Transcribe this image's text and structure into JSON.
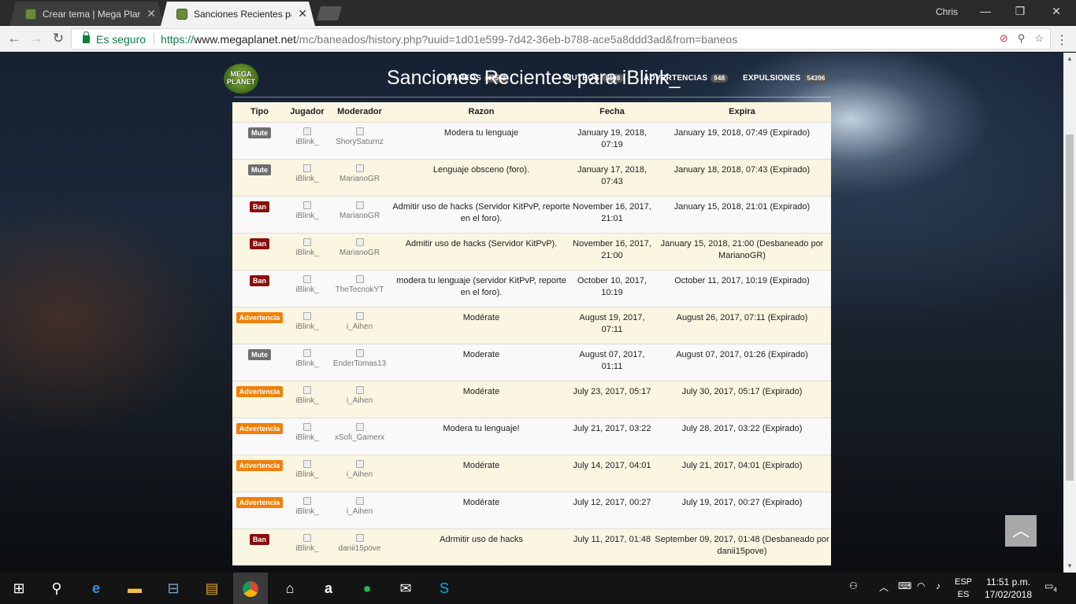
{
  "browser": {
    "tabs": [
      {
        "title": "Crear tema | Mega Planet"
      },
      {
        "title": "Sanciones Recientes para"
      }
    ],
    "profile": "Chris",
    "secure_label": "Es seguro",
    "url_scheme": "https://",
    "url_host": "www.megaplanet.net",
    "url_path": "/mc/baneados/history.php?uuid=1d01e599-7d42-36eb-b788-ace5a8ddd3ad&from=baneos"
  },
  "site": {
    "logo_text": "MEGA PLANET",
    "nav": [
      {
        "label": "BANEOS",
        "count": "47563"
      },
      {
        "label": "MUTEOS",
        "count": "8198"
      },
      {
        "label": "ADVERTENCIAS",
        "count": "948"
      },
      {
        "label": "EXPULSIONES",
        "count": "54396"
      }
    ],
    "title": "Sanciones Recientes para iBlink_"
  },
  "table": {
    "headers": [
      "Tipo",
      "Jugador",
      "Moderador",
      "Razon",
      "Fecha",
      "Expira"
    ],
    "rows": [
      {
        "type": "Mute",
        "player": "iBlink_",
        "moderator": "ShorySaturnz",
        "reason": "Modera tu lenguaje",
        "date": "January 19, 2018, 07:19",
        "expires": "January 19, 2018, 07:49 (Expirado)"
      },
      {
        "type": "Mute",
        "player": "iBlink_",
        "moderator": "MarianoGR",
        "reason": "Lenguaje obsceno (foro).",
        "date": "January 17, 2018, 07:43",
        "expires": "January 18, 2018, 07:43 (Expirado)"
      },
      {
        "type": "Ban",
        "player": "iBlink_",
        "moderator": "MarianoGR",
        "reason": "Admitir uso de hacks (Servidor KitPvP, reporte en el foro).",
        "date": "November 16, 2017, 21:01",
        "expires": "January 15, 2018, 21:01 (Expirado)"
      },
      {
        "type": "Ban",
        "player": "iBlink_",
        "moderator": "MarianoGR",
        "reason": "Admitir uso de hacks (Servidor KitPvP).",
        "date": "November 16, 2017, 21:00",
        "expires": "January 15, 2018, 21:00 (Desbaneado por MarianoGR)"
      },
      {
        "type": "Ban",
        "player": "iBlink_",
        "moderator": "TheTecnokYT",
        "reason": "moderа tu lenguaje (servidor KitPvP, reporte en el foro).",
        "date": "October 10, 2017, 10:19",
        "expires": "October 11, 2017, 10:19 (Expirado)"
      },
      {
        "type": "Advertencia",
        "player": "iBlink_",
        "moderator": "i_Aihen",
        "reason": "Modérate",
        "date": "August 19, 2017, 07:11",
        "expires": "August 26, 2017, 07:11 (Expirado)"
      },
      {
        "type": "Mute",
        "player": "iBlink_",
        "moderator": "EnderTomas13",
        "reason": "Moderate",
        "date": "August 07, 2017, 01:11",
        "expires": "August 07, 2017, 01:26 (Expirado)"
      },
      {
        "type": "Advertencia",
        "player": "iBlink_",
        "moderator": "i_Aihen",
        "reason": "Modérate",
        "date": "July 23, 2017, 05:17",
        "expires": "July 30, 2017, 05:17 (Expirado)"
      },
      {
        "type": "Advertencia",
        "player": "iBlink_",
        "moderator": "xSofi_Gamerx",
        "reason": "Modera tu lenguaje!",
        "date": "July 21, 2017, 03:22",
        "expires": "July 28, 2017, 03:22 (Expirado)"
      },
      {
        "type": "Advertencia",
        "player": "iBlink_",
        "moderator": "i_Aihen",
        "reason": "Modérate",
        "date": "July 14, 2017, 04:01",
        "expires": "July 21, 2017, 04:01 (Expirado)"
      },
      {
        "type": "Advertencia",
        "player": "iBlink_",
        "moderator": "i_Aihen",
        "reason": "Modérate",
        "date": "July 12, 2017, 00:27",
        "expires": "July 19, 2017, 00:27 (Expirado)"
      },
      {
        "type": "Ban",
        "player": "iBlink_",
        "moderator": "danii15pove",
        "reason": "Adrmitir uso de hacks",
        "date": "July 11, 2017, 01:48",
        "expires": "September 09, 2017, 01:48 (Desbaneado por danii15pove)"
      }
    ]
  },
  "taskbar": {
    "lang_top": "ESP",
    "lang_bottom": "ES",
    "time": "11:51 p.m.",
    "date": "17/02/2018",
    "notifications": "4"
  }
}
